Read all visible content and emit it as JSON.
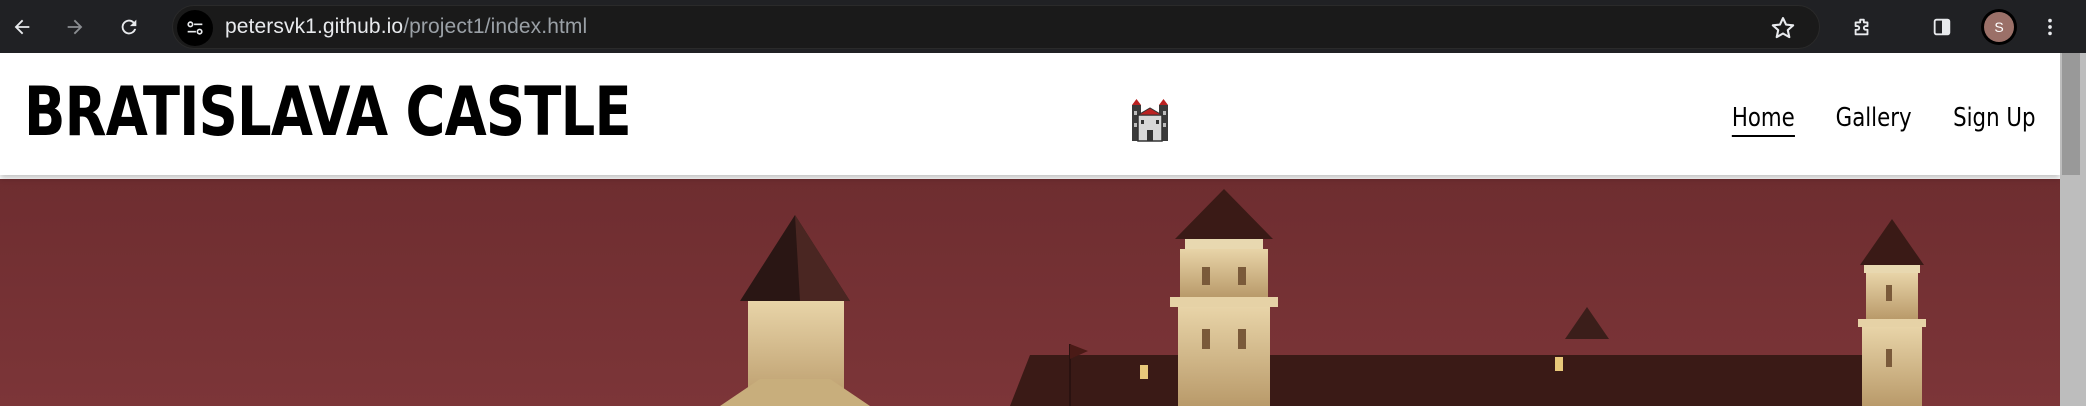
{
  "browser": {
    "url_host": "petersvk1.github.io",
    "url_path": "/project1/index.html",
    "profile_initial": "S",
    "icons": {
      "back": "arrow-left",
      "forward": "arrow-right",
      "reload": "reload",
      "site_info": "tune",
      "bookmark": "star-outline",
      "extensions": "puzzle",
      "side_panel": "side-panel",
      "menu": "three-dots-vertical"
    }
  },
  "header": {
    "title": "BRATISLAVA CASTLE",
    "logo_icon": "castle-icon"
  },
  "nav": {
    "items": [
      {
        "label": "Home",
        "active": true
      },
      {
        "label": "Gallery",
        "active": false
      },
      {
        "label": "Sign Up",
        "active": false
      }
    ]
  },
  "colors": {
    "toolbar_bg": "#202124",
    "hero_sky": "#7a3336",
    "header_bg": "#ffffff"
  }
}
